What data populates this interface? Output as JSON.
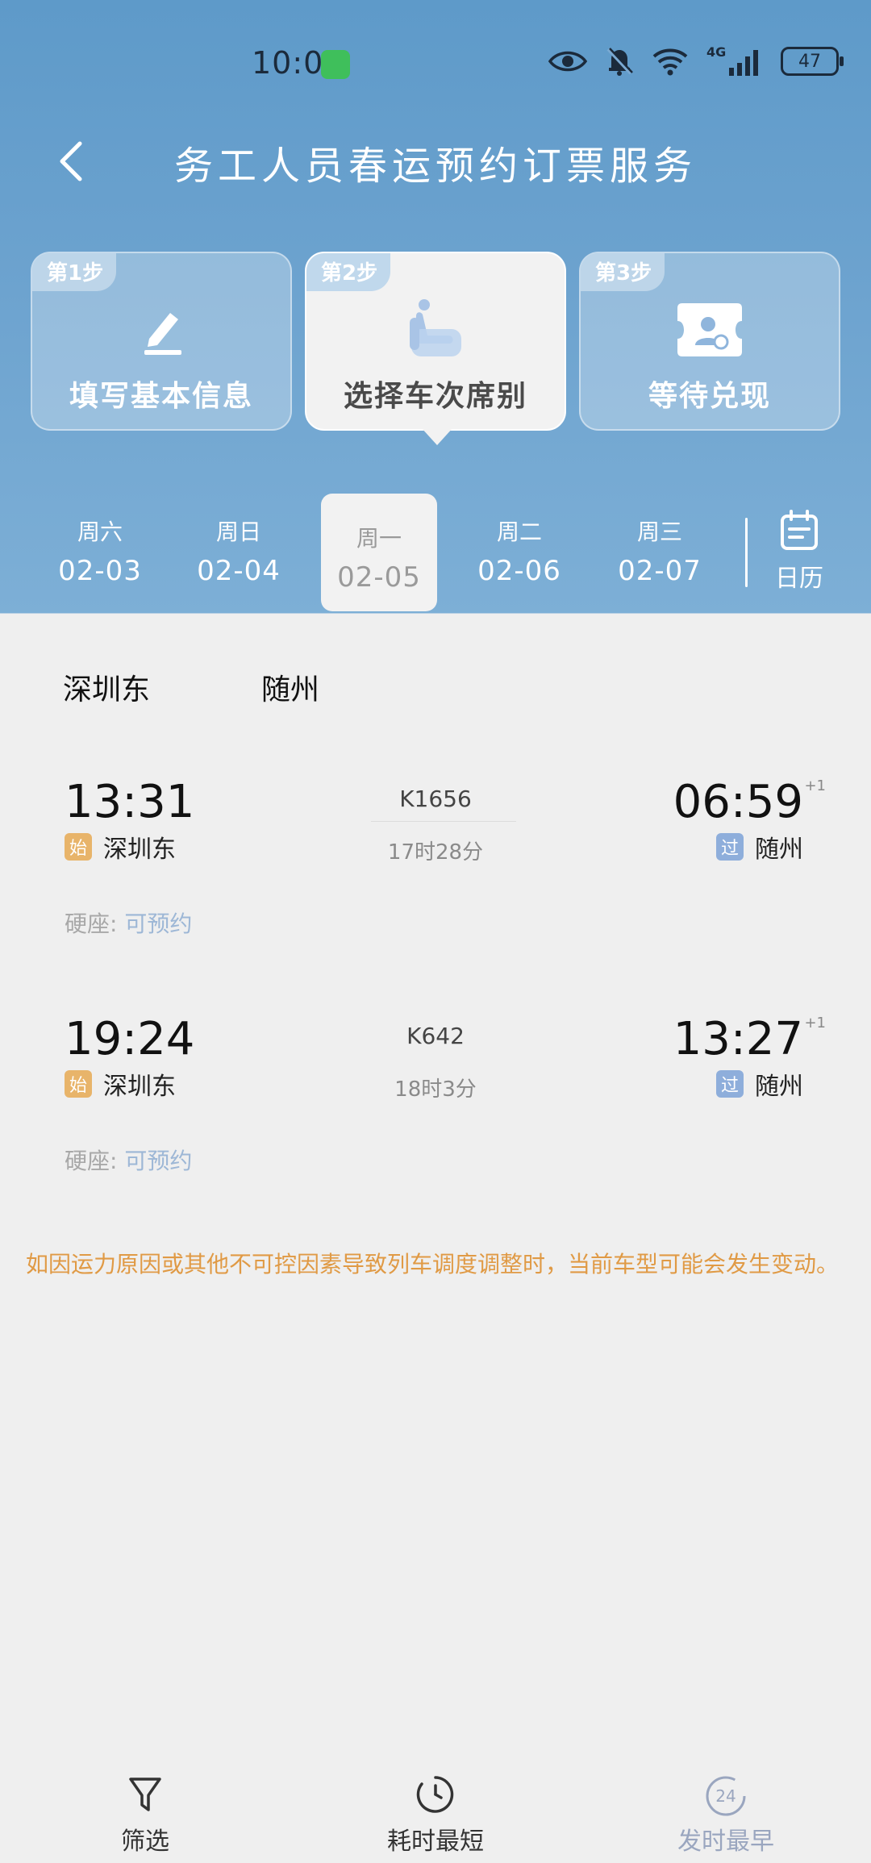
{
  "status_bar": {
    "time": "10:09",
    "battery": "47",
    "network": "4G"
  },
  "header": {
    "title": "务工人员春运预约订票服务"
  },
  "steps": [
    {
      "badge": "第1步",
      "label": "填写基本信息",
      "icon": "pencil-icon"
    },
    {
      "badge": "第2步",
      "label": "选择车次席别",
      "icon": "seat-icon",
      "active": true
    },
    {
      "badge": "第3步",
      "label": "等待兑现",
      "icon": "ticket-icon"
    }
  ],
  "dates": [
    {
      "dow": "周六",
      "date": "02-03"
    },
    {
      "dow": "周日",
      "date": "02-04"
    },
    {
      "dow": "周一",
      "date": "02-05",
      "active": true
    },
    {
      "dow": "周二",
      "date": "02-06"
    },
    {
      "dow": "周三",
      "date": "02-07"
    }
  ],
  "calendar_label": "日历",
  "route": {
    "from": "深圳东",
    "to": "随州"
  },
  "trains": [
    {
      "dep_time": "13:31",
      "code": "K1656",
      "duration": "17时28分",
      "arr_time": "06:59",
      "plus_day": "+1",
      "dep_tag": "始",
      "dep_station": "深圳东",
      "arr_tag": "过",
      "arr_station": "随州",
      "seat_label": "硬座:",
      "seat_status": "可预约"
    },
    {
      "dep_time": "19:24",
      "code": "K642",
      "duration": "18时3分",
      "arr_time": "13:27",
      "plus_day": "+1",
      "dep_tag": "始",
      "dep_station": "深圳东",
      "arr_tag": "过",
      "arr_station": "随州",
      "seat_label": "硬座:",
      "seat_status": "可预约"
    }
  ],
  "notice": "如因运力原因或其他不可控因素导致列车调度调整时，当前车型可能会发生变动。",
  "bottom_bar": {
    "filter": "筛选",
    "shortest": "耗时最短",
    "earliest": "发时最早",
    "earliest_icon_text": "24"
  },
  "colors": {
    "header_blue": "#6da3cf",
    "start_tag": "#e8b46a",
    "pass_tag": "#8eaedb",
    "notice": "#e09a45"
  }
}
